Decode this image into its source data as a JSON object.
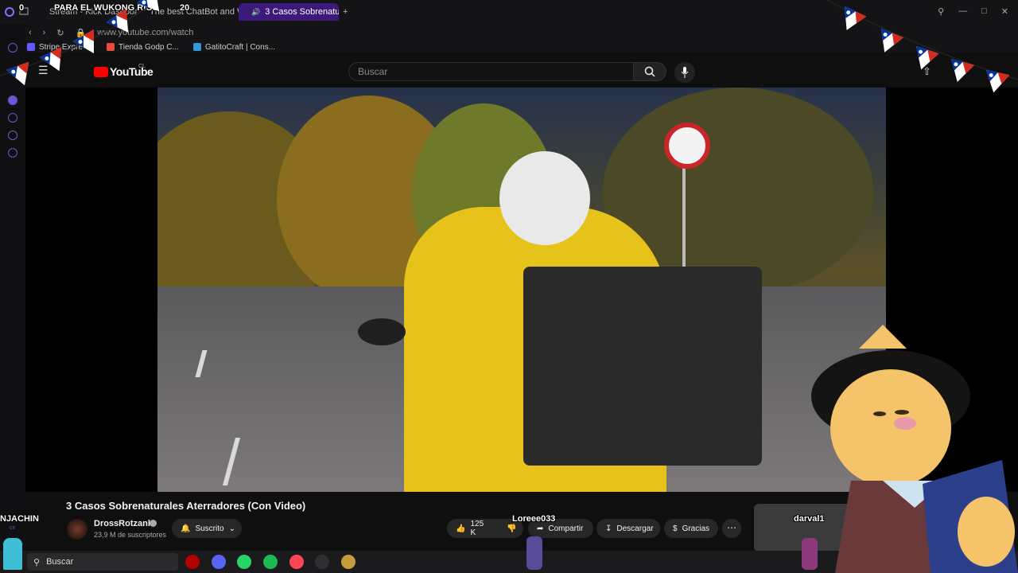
{
  "browser": {
    "tabs": [
      {
        "label": "Stream - Kick Dashboard",
        "color": "#53fc18",
        "active": false
      },
      {
        "label": "The best ChatBot and W",
        "color": "#7a5cff",
        "active": false
      },
      {
        "label": "3 Casos Sobrenaturale",
        "color": "#ff0000",
        "active": true
      }
    ],
    "new_tab": "+",
    "url": "www.youtube.com/watch",
    "bookmarks": [
      {
        "label": "Stripe Expre",
        "color": "#635bff"
      },
      {
        "label": "Tienda Godp C...",
        "color": "#e74c3c"
      },
      {
        "label": "GatitoCraft | Cons...",
        "color": "#3498db"
      }
    ]
  },
  "youtube": {
    "logo_text": "YouTube",
    "country": "CL",
    "search_placeholder": "Buscar",
    "video": {
      "title": "3 Casos Sobrenaturales Aterradores (Con Video)",
      "channel": "DrossRotzank",
      "subscribers": "23,9 M de suscriptores",
      "subscribe_label": "Suscrito",
      "likes": "125 K",
      "share_label": "Compartir",
      "download_label": "Descargar",
      "thanks_label": "Gracias"
    }
  },
  "stream_overlay": {
    "left_counter": "0",
    "goal_text": "PARA EL WUKONG RICO",
    "goal_counter": "20",
    "left_name": "NJACHIN",
    "left_name_sub": "cx",
    "viewer_name": "Loreee033",
    "side_name": "darval1",
    "accent": "#0032a0",
    "flag_red": "#d52b1e"
  },
  "taskbar": {
    "search_label": "Buscar",
    "apps": [
      {
        "name": "brave-icon",
        "color": "#b30000"
      },
      {
        "name": "discord-icon",
        "color": "#5865f2"
      },
      {
        "name": "whatsapp-icon",
        "color": "#25d366"
      },
      {
        "name": "spotify-icon",
        "color": "#1db954"
      },
      {
        "name": "valorant-icon",
        "color": "#ff4655"
      },
      {
        "name": "obs-icon",
        "color": "#302e31"
      },
      {
        "name": "league-icon",
        "color": "#c89b3c"
      }
    ]
  }
}
